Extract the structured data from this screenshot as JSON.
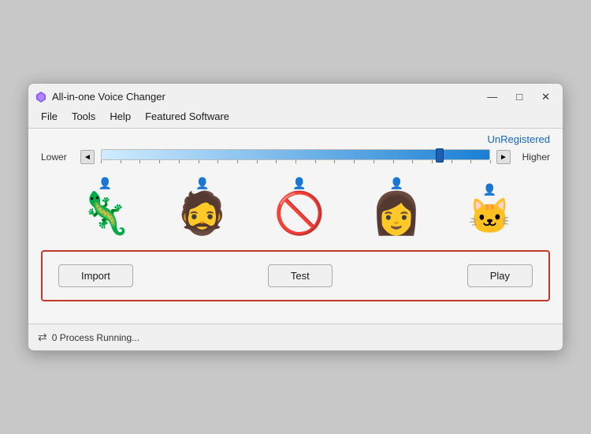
{
  "window": {
    "title": "All-in-one Voice Changer",
    "controls": {
      "minimize": "—",
      "maximize": "□",
      "close": "✕"
    }
  },
  "menubar": {
    "items": [
      "File",
      "Tools",
      "Help",
      "Featured Software"
    ]
  },
  "unregistered": "UnRegistered",
  "pitch": {
    "lower_label": "Lower",
    "higher_label": "Higher",
    "left_arrow": "◄",
    "right_arrow": "►"
  },
  "avatars": [
    {
      "name": "dragon",
      "emoji": "🦎",
      "active": false
    },
    {
      "name": "male-face",
      "emoji": "🧔",
      "active": false
    },
    {
      "name": "blocked",
      "emoji": "🚫",
      "active": false
    },
    {
      "name": "female-face",
      "emoji": "👩",
      "active": false
    },
    {
      "name": "cat",
      "emoji": "🐱",
      "active": false
    }
  ],
  "buttons": {
    "import": "Import",
    "test": "Test",
    "play": "Play"
  },
  "status": {
    "icon": "⇄",
    "text": "0 Process Running..."
  }
}
